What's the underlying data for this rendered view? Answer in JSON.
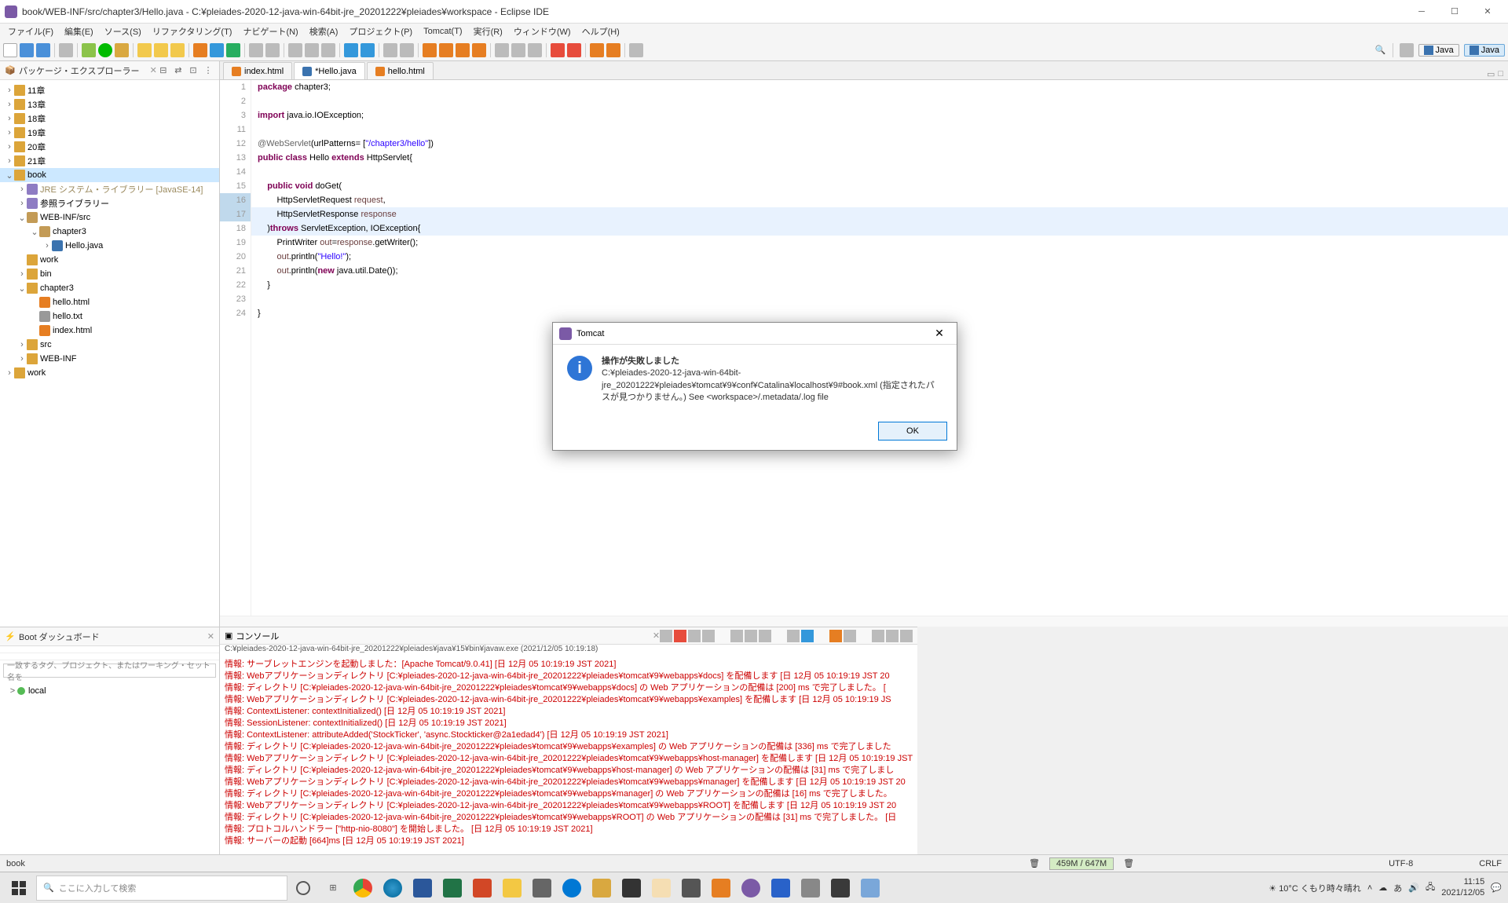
{
  "window": {
    "title": "book/WEB-INF/src/chapter3/Hello.java - C:¥pleiades-2020-12-java-win-64bit-jre_20201222¥pleiades¥workspace - Eclipse IDE"
  },
  "menubar": [
    "ファイル(F)",
    "編集(E)",
    "ソース(S)",
    "リファクタリング(T)",
    "ナビゲート(N)",
    "検索(A)",
    "プロジェクト(P)",
    "Tomcat(T)",
    "実行(R)",
    "ウィンドウ(W)",
    "ヘルプ(H)"
  ],
  "perspectives": {
    "java": "Java",
    "javaee": "Java"
  },
  "package_explorer": {
    "title": "パッケージ・エクスプローラー",
    "tree": [
      {
        "d": 0,
        "tw": ">",
        "ic": "folder",
        "label": "11章"
      },
      {
        "d": 0,
        "tw": ">",
        "ic": "folder",
        "label": "13章"
      },
      {
        "d": 0,
        "tw": ">",
        "ic": "folder",
        "label": "18章"
      },
      {
        "d": 0,
        "tw": ">",
        "ic": "folder",
        "label": "19章"
      },
      {
        "d": 0,
        "tw": ">",
        "ic": "folder",
        "label": "20章"
      },
      {
        "d": 0,
        "tw": ">",
        "ic": "folder",
        "label": "21章"
      },
      {
        "d": 0,
        "tw": "v",
        "ic": "folder",
        "label": "book",
        "sel": true
      },
      {
        "d": 1,
        "tw": ">",
        "ic": "lib",
        "label": "JRE システム・ライブラリー [JavaSE-14]",
        "gray": true
      },
      {
        "d": 1,
        "tw": ">",
        "ic": "lib",
        "label": "参照ライブラリー"
      },
      {
        "d": 1,
        "tw": "v",
        "ic": "pkg",
        "label": "WEB-INF/src"
      },
      {
        "d": 2,
        "tw": "v",
        "ic": "pkg",
        "label": "chapter3"
      },
      {
        "d": 3,
        "tw": ">",
        "ic": "java",
        "label": "Hello.java"
      },
      {
        "d": 1,
        "tw": "",
        "ic": "folder",
        "label": "work"
      },
      {
        "d": 1,
        "tw": ">",
        "ic": "folder",
        "label": "bin"
      },
      {
        "d": 1,
        "tw": "v",
        "ic": "folder",
        "label": "chapter3"
      },
      {
        "d": 2,
        "tw": "",
        "ic": "html",
        "label": "hello.html"
      },
      {
        "d": 2,
        "tw": "",
        "ic": "txt",
        "label": "hello.txt"
      },
      {
        "d": 2,
        "tw": "",
        "ic": "html",
        "label": "index.html"
      },
      {
        "d": 1,
        "tw": ">",
        "ic": "folder",
        "label": "src"
      },
      {
        "d": 1,
        "tw": ">",
        "ic": "folder",
        "label": "WEB-INF"
      },
      {
        "d": 0,
        "tw": ">",
        "ic": "folder",
        "label": "work"
      }
    ]
  },
  "editor_tabs": [
    {
      "label": "index.html",
      "ic": "html"
    },
    {
      "label": "*Hello.java",
      "ic": "java",
      "active": true
    },
    {
      "label": "hello.html",
      "ic": "html"
    }
  ],
  "code": {
    "start_line": 1,
    "lines": [
      [
        {
          "t": "package ",
          "c": "kw"
        },
        {
          "t": "chapter3;"
        }
      ],
      [],
      [
        {
          "t": "import ",
          "c": "kw"
        },
        {
          "t": "java.io.IOException;"
        }
      ],
      [],
      [
        {
          "t": "@WebServlet",
          "c": "ann"
        },
        {
          "t": "(urlPatterns= ["
        },
        {
          "t": "\"/chapter3/hello\"",
          "c": "str"
        },
        {
          "t": "])"
        }
      ],
      [
        {
          "t": "public class ",
          "c": "kw"
        },
        {
          "t": "Hello "
        },
        {
          "t": "extends ",
          "c": "kw"
        },
        {
          "t": "HttpServlet{"
        }
      ],
      [],
      [
        {
          "t": "    "
        },
        {
          "t": "public void ",
          "c": "kw"
        },
        {
          "t": "doGet("
        }
      ],
      [
        {
          "t": "        HttpServletRequest "
        },
        {
          "t": "request",
          "c": "fld"
        },
        {
          "t": ","
        }
      ],
      [
        {
          "t": "        HttpServletResponse "
        },
        {
          "t": "response",
          "c": "fld"
        }
      ],
      [
        {
          "t": "    )"
        },
        {
          "t": "throws ",
          "c": "kw"
        },
        {
          "t": "ServletException, IOException{"
        }
      ],
      [
        {
          "t": "        PrintWriter "
        },
        {
          "t": "out",
          "c": "fld"
        },
        {
          "t": "="
        },
        {
          "t": "response",
          "c": "fld"
        },
        {
          "t": ".getWriter();"
        }
      ],
      [
        {
          "t": "        "
        },
        {
          "t": "out",
          "c": "fld"
        },
        {
          "t": ".println("
        },
        {
          "t": "\"Hello!\"",
          "c": "str"
        },
        {
          "t": ");"
        }
      ],
      [
        {
          "t": "        "
        },
        {
          "t": "out",
          "c": "fld"
        },
        {
          "t": ".println("
        },
        {
          "t": "new ",
          "c": "kw"
        },
        {
          "t": "java.util.Date());"
        }
      ],
      [
        {
          "t": "    }"
        }
      ],
      [],
      [
        {
          "t": "}"
        }
      ]
    ],
    "line_numbers": [
      1,
      2,
      3,
      "",
      11,
      12,
      13,
      14,
      15,
      16,
      17,
      18,
      19,
      20,
      21,
      22,
      23,
      24
    ],
    "highlighted": [
      9,
      10
    ]
  },
  "boot_dashboard": {
    "title": "Boot ダッシュボード",
    "search_placeholder": "一致するタグ、プロジェクト、またはワーキング・セット名を",
    "items": [
      "local"
    ]
  },
  "console": {
    "title": "コンソール",
    "subtitle": "C:¥pleiades-2020-12-java-win-64bit-jre_20201222¥pleiades¥java¥15¥bin¥javaw.exe (2021/12/05 10:19:18)",
    "lines": [
      "情報: サーブレットエンジンを起動しました：[Apache Tomcat/9.0.41] [日 12月 05 10:19:19 JST 2021]",
      "情報: Webアプリケーションディレクトリ [C:¥pleiades-2020-12-java-win-64bit-jre_20201222¥pleiades¥tomcat¥9¥webapps¥docs] を配備します [日 12月 05 10:19:19 JST 20",
      "情報: ディレクトリ [C:¥pleiades-2020-12-java-win-64bit-jre_20201222¥pleiades¥tomcat¥9¥webapps¥docs] の Web アプリケーションの配備は [200] ms で完了しました。 [",
      "情報: Webアプリケーションディレクトリ [C:¥pleiades-2020-12-java-win-64bit-jre_20201222¥pleiades¥tomcat¥9¥webapps¥examples] を配備します [日 12月 05 10:19:19 JS",
      "情報: ContextListener: contextInitialized() [日 12月 05 10:19:19 JST 2021]",
      "情報: SessionListener: contextInitialized() [日 12月 05 10:19:19 JST 2021]",
      "情報: ContextListener: attributeAdded('StockTicker', 'async.Stockticker@2a1edad4') [日 12月 05 10:19:19 JST 2021]",
      "情報: ディレクトリ [C:¥pleiades-2020-12-java-win-64bit-jre_20201222¥pleiades¥tomcat¥9¥webapps¥examples] の Web アプリケーションの配備は [336] ms で完了しました",
      "情報: Webアプリケーションディレクトリ [C:¥pleiades-2020-12-java-win-64bit-jre_20201222¥pleiades¥tomcat¥9¥webapps¥host-manager] を配備します [日 12月 05 10:19:19 JST",
      "情報: ディレクトリ [C:¥pleiades-2020-12-java-win-64bit-jre_20201222¥pleiades¥tomcat¥9¥webapps¥host-manager] の Web アプリケーションの配備は [31] ms で完了しまし",
      "情報: Webアプリケーションディレクトリ [C:¥pleiades-2020-12-java-win-64bit-jre_20201222¥pleiades¥tomcat¥9¥webapps¥manager] を配備します [日 12月 05 10:19:19 JST 20",
      "情報: ディレクトリ [C:¥pleiades-2020-12-java-win-64bit-jre_20201222¥pleiades¥tomcat¥9¥webapps¥manager] の Web アプリケーションの配備は [16] ms で完了しました。",
      "情報: Webアプリケーションディレクトリ [C:¥pleiades-2020-12-java-win-64bit-jre_20201222¥pleiades¥tomcat¥9¥webapps¥ROOT] を配備します [日 12月 05 10:19:19 JST 20",
      "情報: ディレクトリ [C:¥pleiades-2020-12-java-win-64bit-jre_20201222¥pleiades¥tomcat¥9¥webapps¥ROOT] の Web アプリケーションの配備は [31] ms で完了しました。 [日",
      "情報: プロトコルハンドラー [\"http-nio-8080\"] を開始しました。 [日 12月 05 10:19:19 JST 2021]",
      "情報: サーバーの起動 [664]ms [日 12月 05 10:19:19 JST 2021]"
    ]
  },
  "dialog": {
    "title": "Tomcat",
    "heading": "操作が失敗しました",
    "body": "C:¥pleiades-2020-12-java-win-64bit-jre_20201222¥pleiades¥tomcat¥9¥conf¥Catalina¥localhost¥9#book.xml (指定されたパスが見つかりません。) See <workspace>/.metadata/.log file",
    "ok": "OK"
  },
  "statusbar": {
    "path": "book",
    "memory": "459M / 647M",
    "encoding": "UTF-8",
    "lineend": "CRLF"
  },
  "taskbar": {
    "search_placeholder": "ここに入力して検索",
    "weather": "10°C くもり時々晴れ",
    "time": "11:15",
    "date": "2021/12/05"
  }
}
